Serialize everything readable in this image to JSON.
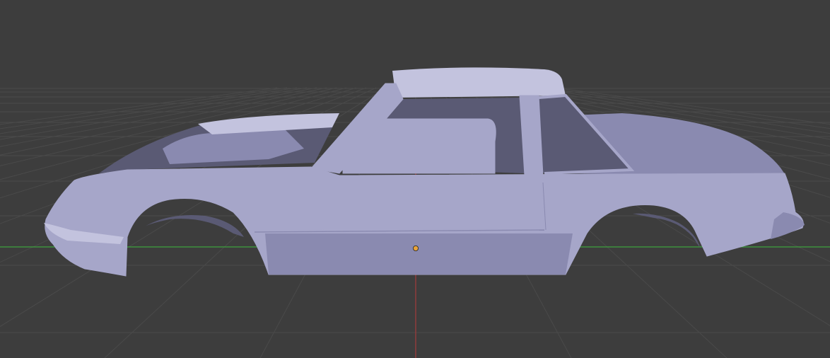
{
  "viewport": {
    "background_color": "#3d3d3d",
    "grid_color": "#4a4a4a",
    "x_axis_color": "#3ea33e",
    "z_axis_color": "#a33b3b",
    "origin_marker_color": "#e8a33a"
  },
  "model": {
    "body_color": "#a6a6c9",
    "shade_color": "#8a8ab0",
    "dark_color": "#5a5a74",
    "highlight_color": "#c3c3de"
  },
  "icons": {
    "origin": "object-origin-icon"
  }
}
